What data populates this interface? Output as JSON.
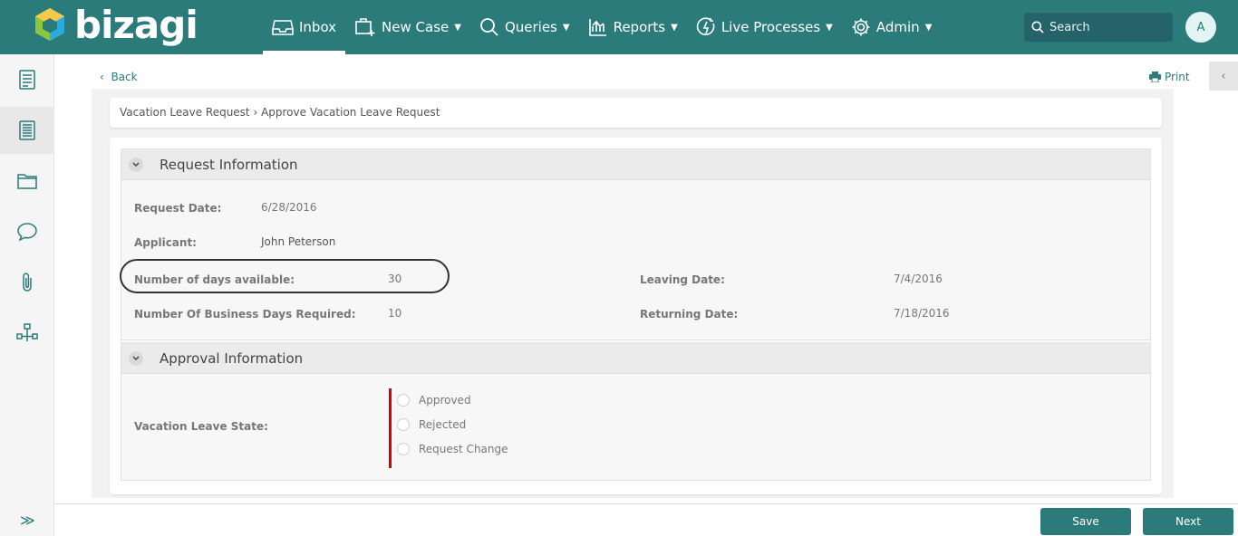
{
  "brand": {
    "name": "bizagi",
    "color": "#2c7b7b"
  },
  "nav": {
    "items": [
      {
        "label": "Inbox",
        "icon": "inbox-icon",
        "active": true
      },
      {
        "label": "New Case",
        "icon": "new-case-icon",
        "dropdown": true
      },
      {
        "label": "Queries",
        "icon": "search-icon",
        "dropdown": true
      },
      {
        "label": "Reports",
        "icon": "reports-icon",
        "dropdown": true
      },
      {
        "label": "Live Processes",
        "icon": "live-processes-icon",
        "dropdown": true
      },
      {
        "label": "Admin",
        "icon": "gear-icon",
        "dropdown": true
      }
    ]
  },
  "search": {
    "placeholder": "Search"
  },
  "user": {
    "initial": "A"
  },
  "sidebar": {
    "items": [
      {
        "icon": "activity-form-icon"
      },
      {
        "icon": "summary-icon",
        "active": true
      },
      {
        "icon": "folder-icon"
      },
      {
        "icon": "comments-icon"
      },
      {
        "icon": "attachment-icon"
      },
      {
        "icon": "process-map-icon"
      }
    ],
    "expand_icon": "double-chevron-right-icon"
  },
  "page": {
    "back_label": "Back",
    "print_label": "Print",
    "breadcrumb": "Vacation Leave Request › Approve Vacation Leave Request"
  },
  "request_info": {
    "title": "Request Information",
    "fields": {
      "request_date": {
        "label": "Request Date:",
        "value": "6/28/2016"
      },
      "applicant": {
        "label": "Applicant:",
        "value": "John Peterson"
      },
      "days_available": {
        "label": "Number of days available:",
        "value": "30"
      },
      "business_days": {
        "label": "Number Of Business Days Required:",
        "value": "10"
      },
      "leaving_date": {
        "label": "Leaving Date:",
        "value": "7/4/2016"
      },
      "returning_date": {
        "label": "Returning Date:",
        "value": "7/18/2016"
      }
    }
  },
  "approval_info": {
    "title": "Approval Information",
    "state_label": "Vacation Leave State:",
    "options": [
      "Approved",
      "Rejected",
      "Request Change"
    ],
    "required_color": "#d60000"
  },
  "actions": {
    "save_label": "Save",
    "next_label": "Next"
  }
}
